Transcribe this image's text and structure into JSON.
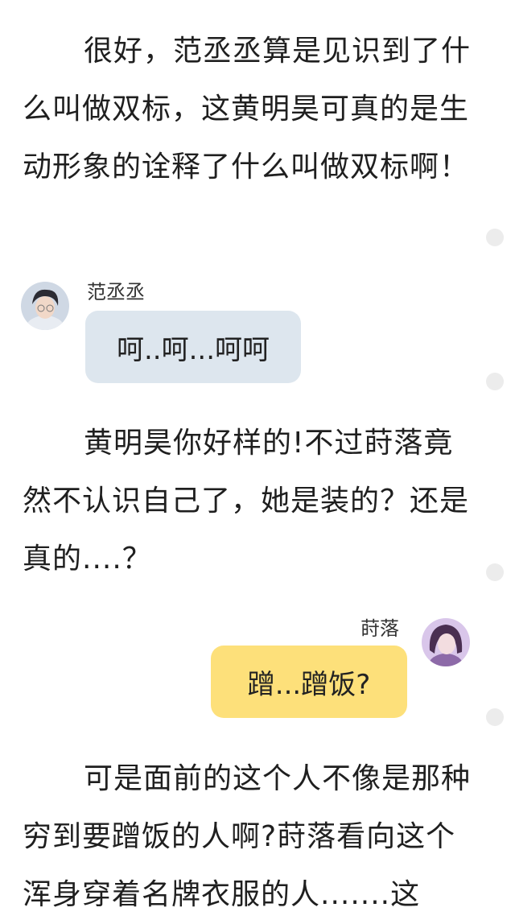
{
  "paragraphs": [
    "很好，范丞丞算是见识到了什么叫做双标，这黄明昊可真的是生动形象的诠释了什么叫做双标啊！",
    "黄明昊你好样的!不过莳落竟然不认识自己了，她是装的？还是真的....？",
    "可是面前的这个人不像是那种穷到要蹭饭的人啊?莳落看向这个浑身穿着名牌衣服的人.......这"
  ],
  "messages": [
    {
      "side": "left",
      "sender": "范丞丞",
      "text": "呵..呵...呵呵"
    },
    {
      "side": "right",
      "sender": "莳落",
      "text": "蹭...蹭饭?"
    }
  ],
  "colors": {
    "text": "#1f1f1f",
    "left_bubble": "#dde6ee",
    "right_bubble": "#fde07a",
    "side_dot": "#ececec"
  }
}
